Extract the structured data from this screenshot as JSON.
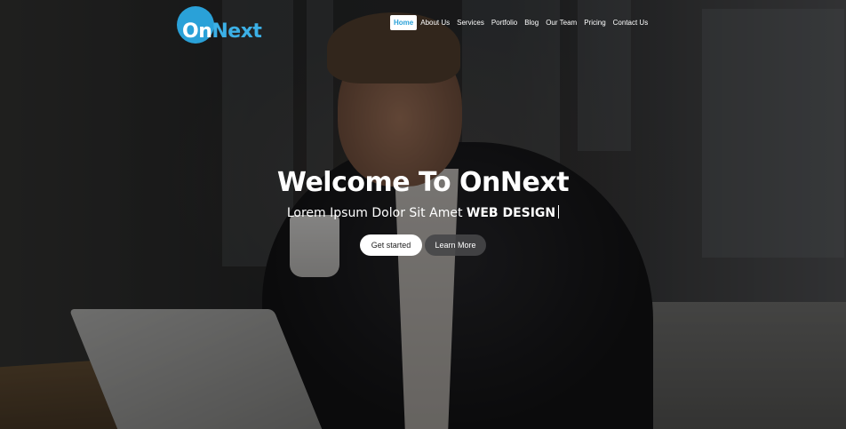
{
  "logo": {
    "part1": "On",
    "part2": "Next",
    "accent": "#2aa1d8"
  },
  "nav": {
    "items": [
      {
        "label": "Home",
        "active": true
      },
      {
        "label": "About Us",
        "active": false
      },
      {
        "label": "Services",
        "active": false
      },
      {
        "label": "Portfolio",
        "active": false
      },
      {
        "label": "Blog",
        "active": false
      },
      {
        "label": "Our Team",
        "active": false
      },
      {
        "label": "Pricing",
        "active": false
      },
      {
        "label": "Contact Us",
        "active": false
      }
    ]
  },
  "hero": {
    "title": "Welcome To OnNext",
    "subtitle_plain": "Lorem Ipsum Dolor Sit Amet ",
    "subtitle_strong": "WEB DESIGN",
    "primary_button": "Get started",
    "secondary_button": "Learn More"
  }
}
